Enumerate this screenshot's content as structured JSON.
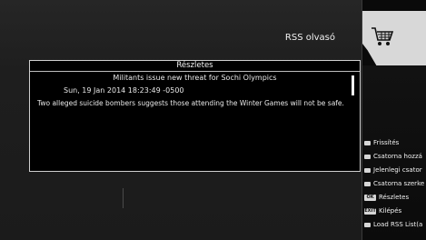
{
  "header": {
    "title": "RSS olvasó",
    "cart_icon": "cart-icon"
  },
  "dialog": {
    "title": "Részletes",
    "headline": "Militants issue new threat for Sochi Olympics",
    "date": "Sun, 19 Jan 2014 18:23:49 -0500",
    "description": "Two alleged suicide bombers suggests those attending the Winter Games will not be safe."
  },
  "menu": {
    "items": [
      {
        "key": "",
        "label": "Frissítés"
      },
      {
        "key": "",
        "label": "Csatorna hozzá"
      },
      {
        "key": "",
        "label": "Jelenlegi csator"
      },
      {
        "key": "",
        "label": "Csatorna szerke"
      },
      {
        "key": "OK",
        "label": "Részletes"
      },
      {
        "key": "EXIT",
        "label": "Kilépés"
      },
      {
        "key": "",
        "label": "Load RSS List(a"
      }
    ]
  }
}
